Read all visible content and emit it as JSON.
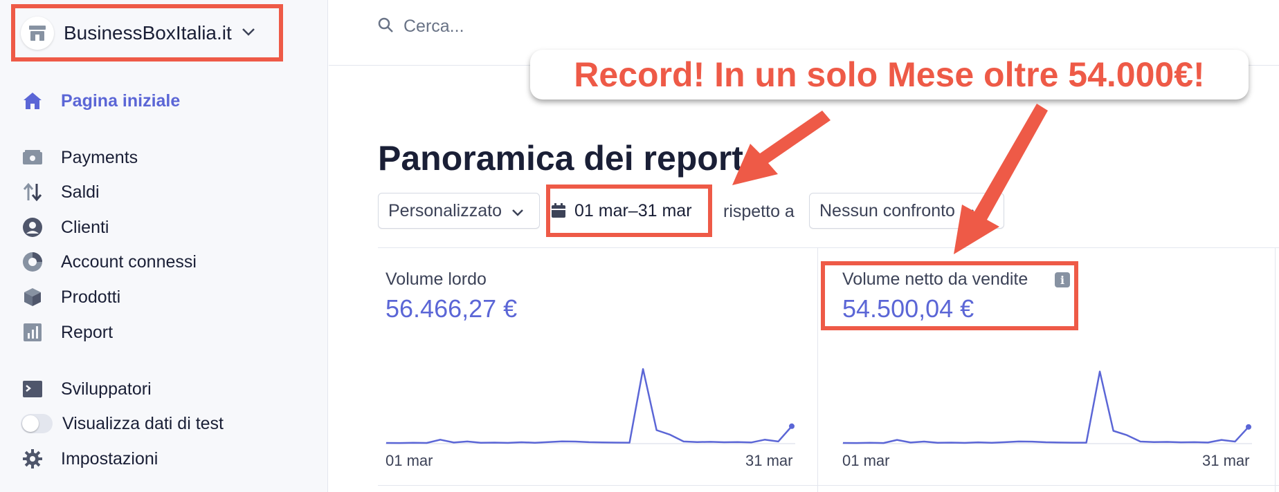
{
  "account": {
    "name": "BusinessBoxItalia.it"
  },
  "nav": {
    "home": "Pagina iniziale",
    "payments": "Payments",
    "balances": "Saldi",
    "customers": "Clienti",
    "connected": "Account connessi",
    "products": "Prodotti",
    "reports": "Report",
    "developers": "Sviluppatori",
    "test_data": "Visualizza dati di test",
    "settings": "Impostazioni"
  },
  "search": {
    "placeholder": "Cerca..."
  },
  "page": {
    "title": "Panoramica dei report"
  },
  "filters": {
    "period": "Personalizzato",
    "date_range": "01 mar–31 mar",
    "compare_label": "rispetto a",
    "compare_value": "Nessun confronto"
  },
  "cards": [
    {
      "label": "Volume lordo",
      "value": "56.466,27 €",
      "x_start": "01 mar",
      "x_end": "31 mar"
    },
    {
      "label": "Volume netto da vendite",
      "value": "54.500,04 €",
      "x_start": "01 mar",
      "x_end": "31 mar"
    }
  ],
  "annotation": {
    "text": "Record! In un solo Mese oltre 54.000€!"
  },
  "colors": {
    "accent": "#5b66d6",
    "highlight": "#ee5a47"
  },
  "chart_data": [
    {
      "type": "line",
      "title": "Volume lordo",
      "x": [
        "01 mar",
        "02 mar",
        "03 mar",
        "04 mar",
        "05 mar",
        "06 mar",
        "07 mar",
        "08 mar",
        "09 mar",
        "10 mar",
        "11 mar",
        "12 mar",
        "13 mar",
        "14 mar",
        "15 mar",
        "16 mar",
        "17 mar",
        "18 mar",
        "19 mar",
        "20 mar",
        "21 mar",
        "22 mar",
        "23 mar",
        "24 mar",
        "25 mar",
        "26 mar",
        "27 mar",
        "28 mar",
        "29 mar",
        "30 mar",
        "31 mar"
      ],
      "values": [
        200,
        180,
        260,
        190,
        1100,
        320,
        600,
        250,
        300,
        220,
        380,
        260,
        420,
        640,
        580,
        400,
        330,
        290,
        280,
        21000,
        3800,
        2500,
        600,
        450,
        500,
        380,
        420,
        330,
        1100,
        600,
        4900
      ],
      "ylim": [
        0,
        21000
      ],
      "grid": false
    },
    {
      "type": "line",
      "title": "Volume netto da vendite",
      "x": [
        "01 mar",
        "02 mar",
        "03 mar",
        "04 mar",
        "05 mar",
        "06 mar",
        "07 mar",
        "08 mar",
        "09 mar",
        "10 mar",
        "11 mar",
        "12 mar",
        "13 mar",
        "14 mar",
        "15 mar",
        "16 mar",
        "17 mar",
        "18 mar",
        "19 mar",
        "20 mar",
        "21 mar",
        "22 mar",
        "23 mar",
        "24 mar",
        "25 mar",
        "26 mar",
        "27 mar",
        "28 mar",
        "29 mar",
        "30 mar",
        "31 mar"
      ],
      "values": [
        190,
        170,
        250,
        180,
        1050,
        310,
        580,
        240,
        290,
        210,
        360,
        250,
        400,
        610,
        560,
        380,
        320,
        280,
        270,
        20300,
        3600,
        2400,
        580,
        430,
        480,
        370,
        400,
        320,
        1050,
        580,
        4700
      ],
      "ylim": [
        0,
        21000
      ],
      "grid": false
    }
  ]
}
